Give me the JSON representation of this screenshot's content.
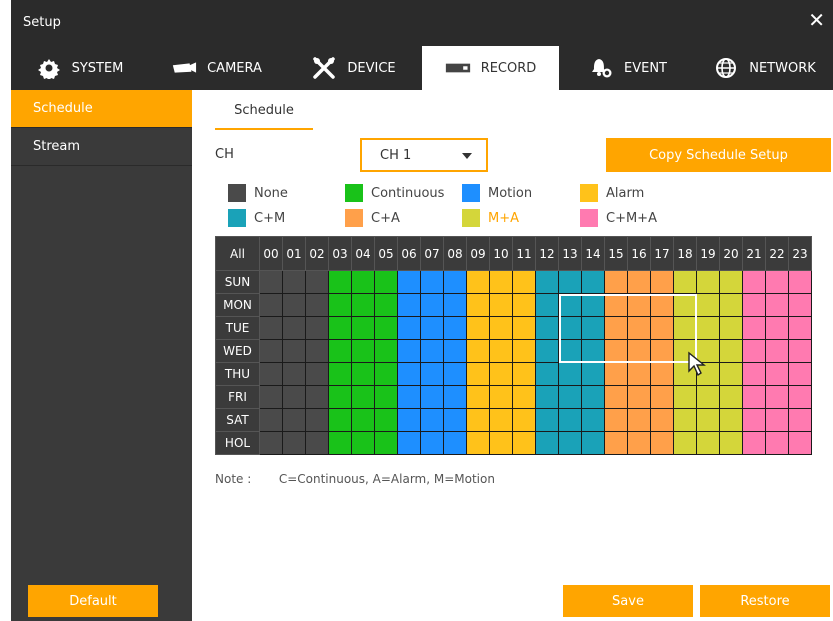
{
  "window": {
    "title": "Setup",
    "close_label": "✕"
  },
  "tabs": [
    {
      "label": "SYSTEM",
      "icon": "gear-icon",
      "active": false
    },
    {
      "label": "CAMERA",
      "icon": "camera-icon",
      "active": false
    },
    {
      "label": "DEVICE",
      "icon": "tools-icon",
      "active": false
    },
    {
      "label": "RECORD",
      "icon": "record-icon",
      "active": true
    },
    {
      "label": "EVENT",
      "icon": "bell-icon",
      "active": false
    },
    {
      "label": "NETWORK",
      "icon": "globe-icon",
      "active": false
    }
  ],
  "sidebar": {
    "items": [
      {
        "label": "Schedule",
        "active": true
      },
      {
        "label": "Stream",
        "active": false
      }
    ],
    "default_label": "Default"
  },
  "main": {
    "subtab_label": "Schedule",
    "ch_label": "CH",
    "ch_value": "CH 1",
    "copy_label": "Copy Schedule Setup",
    "note_title": "Note :",
    "note_text": "C=Continuous, A=Alarm, M=Motion",
    "save_label": "Save",
    "restore_label": "Restore"
  },
  "legend": [
    {
      "label": "None",
      "color": "#4a4a4a"
    },
    {
      "label": "Continuous",
      "color": "#19c219"
    },
    {
      "label": "Motion",
      "color": "#1e8fff"
    },
    {
      "label": "Alarm",
      "color": "#ffc21a"
    },
    {
      "label": "C+M",
      "color": "#1aa2b8"
    },
    {
      "label": "C+A",
      "color": "#ffa04a"
    },
    {
      "label": "M+A",
      "color": "#d4d63a"
    },
    {
      "label": "C+M+A",
      "color": "#ff7ab0"
    }
  ],
  "schedule": {
    "all_label": "All",
    "hours": [
      "00",
      "01",
      "02",
      "03",
      "04",
      "05",
      "06",
      "07",
      "08",
      "09",
      "10",
      "11",
      "12",
      "13",
      "14",
      "15",
      "16",
      "17",
      "18",
      "19",
      "20",
      "21",
      "22",
      "23"
    ],
    "days": [
      "SUN",
      "MON",
      "TUE",
      "WED",
      "THU",
      "FRI",
      "SAT",
      "HOL"
    ],
    "hour_modes": [
      0,
      0,
      0,
      1,
      1,
      1,
      2,
      2,
      2,
      3,
      3,
      3,
      4,
      4,
      4,
      5,
      5,
      5,
      6,
      6,
      6,
      7,
      7,
      7
    ],
    "selection": {
      "from_hour": 13,
      "to_hour": 18,
      "from_day": "MON",
      "to_day": "WED"
    }
  }
}
